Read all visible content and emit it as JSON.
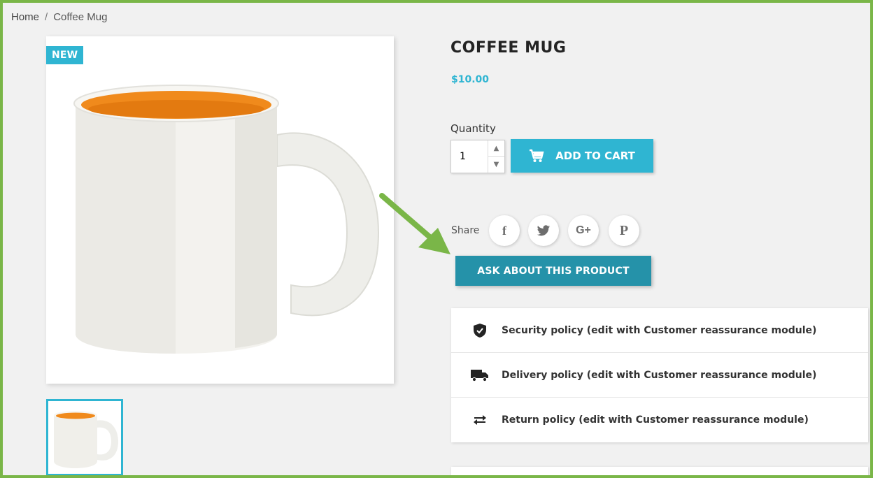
{
  "breadcrumb": {
    "home": "Home",
    "separator": "/",
    "current": "Coffee Mug"
  },
  "product": {
    "badge": "NEW",
    "title": "COFFEE MUG",
    "price": "$10.00",
    "quantity_label": "Quantity",
    "quantity_value": "1",
    "add_to_cart_label": "ADD TO CART"
  },
  "share": {
    "label": "Share",
    "icons": {
      "facebook": "f",
      "twitter": "t",
      "googleplus": "G+",
      "pinterest": "P"
    }
  },
  "ask_button_label": "ASK ABOUT THIS PRODUCT",
  "reassurance": [
    {
      "icon": "shield-icon",
      "label": "Security policy (edit with Customer reassurance module)"
    },
    {
      "icon": "truck-icon",
      "label": "Delivery policy (edit with Customer reassurance module)"
    },
    {
      "icon": "swap-arrows-icon",
      "label": "Return policy (edit with Customer reassurance module)"
    }
  ],
  "colors": {
    "accent": "#2fb5d2",
    "ask_button": "#2592a9",
    "annotation": "#7ab648",
    "mug_inside": "#f08a1c"
  }
}
